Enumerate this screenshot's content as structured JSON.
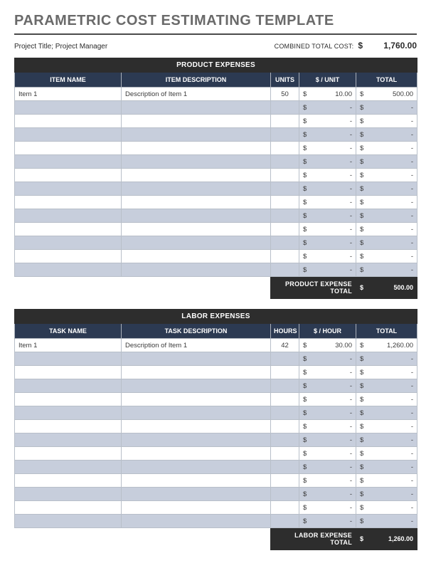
{
  "title": "PARAMETRIC COST ESTIMATING TEMPLATE",
  "meta": {
    "left": "Project Title; Project Manager",
    "combined_label": "COMBINED TOTAL COST:",
    "currency": "$",
    "combined_total": "1,760.00"
  },
  "product": {
    "section_title": "PRODUCT EXPENSES",
    "headers": {
      "name": "ITEM NAME",
      "desc": "ITEM DESCRIPTION",
      "units": "UNITS",
      "rate": "$ / UNIT",
      "total": "TOTAL"
    },
    "rows": [
      {
        "name": "Item 1",
        "desc": "Description of Item 1",
        "units": "50",
        "rate": "10.00",
        "total": "500.00"
      },
      {
        "name": "",
        "desc": "",
        "units": "",
        "rate": "-",
        "total": "-"
      },
      {
        "name": "",
        "desc": "",
        "units": "",
        "rate": "-",
        "total": "-"
      },
      {
        "name": "",
        "desc": "",
        "units": "",
        "rate": "-",
        "total": "-"
      },
      {
        "name": "",
        "desc": "",
        "units": "",
        "rate": "-",
        "total": "-"
      },
      {
        "name": "",
        "desc": "",
        "units": "",
        "rate": "-",
        "total": "-"
      },
      {
        "name": "",
        "desc": "",
        "units": "",
        "rate": "-",
        "total": "-"
      },
      {
        "name": "",
        "desc": "",
        "units": "",
        "rate": "-",
        "total": "-"
      },
      {
        "name": "",
        "desc": "",
        "units": "",
        "rate": "-",
        "total": "-"
      },
      {
        "name": "",
        "desc": "",
        "units": "",
        "rate": "-",
        "total": "-"
      },
      {
        "name": "",
        "desc": "",
        "units": "",
        "rate": "-",
        "total": "-"
      },
      {
        "name": "",
        "desc": "",
        "units": "",
        "rate": "-",
        "total": "-"
      },
      {
        "name": "",
        "desc": "",
        "units": "",
        "rate": "-",
        "total": "-"
      },
      {
        "name": "",
        "desc": "",
        "units": "",
        "rate": "-",
        "total": "-"
      }
    ],
    "total_label": "PRODUCT EXPENSE TOTAL",
    "total_value": "500.00"
  },
  "labor": {
    "section_title": "LABOR EXPENSES",
    "headers": {
      "name": "TASK NAME",
      "desc": "TASK DESCRIPTION",
      "units": "HOURS",
      "rate": "$ / HOUR",
      "total": "TOTAL"
    },
    "rows": [
      {
        "name": "Item 1",
        "desc": "Description of Item 1",
        "units": "42",
        "rate": "30.00",
        "total": "1,260.00"
      },
      {
        "name": "",
        "desc": "",
        "units": "",
        "rate": "-",
        "total": "-"
      },
      {
        "name": "",
        "desc": "",
        "units": "",
        "rate": "-",
        "total": "-"
      },
      {
        "name": "",
        "desc": "",
        "units": "",
        "rate": "-",
        "total": "-"
      },
      {
        "name": "",
        "desc": "",
        "units": "",
        "rate": "-",
        "total": "-"
      },
      {
        "name": "",
        "desc": "",
        "units": "",
        "rate": "-",
        "total": "-"
      },
      {
        "name": "",
        "desc": "",
        "units": "",
        "rate": "-",
        "total": "-"
      },
      {
        "name": "",
        "desc": "",
        "units": "",
        "rate": "-",
        "total": "-"
      },
      {
        "name": "",
        "desc": "",
        "units": "",
        "rate": "-",
        "total": "-"
      },
      {
        "name": "",
        "desc": "",
        "units": "",
        "rate": "-",
        "total": "-"
      },
      {
        "name": "",
        "desc": "",
        "units": "",
        "rate": "-",
        "total": "-"
      },
      {
        "name": "",
        "desc": "",
        "units": "",
        "rate": "-",
        "total": "-"
      },
      {
        "name": "",
        "desc": "",
        "units": "",
        "rate": "-",
        "total": "-"
      },
      {
        "name": "",
        "desc": "",
        "units": "",
        "rate": "-",
        "total": "-"
      }
    ],
    "total_label": "LABOR EXPENSE TOTAL",
    "total_value": "1,260.00"
  },
  "currency_symbol": "$"
}
